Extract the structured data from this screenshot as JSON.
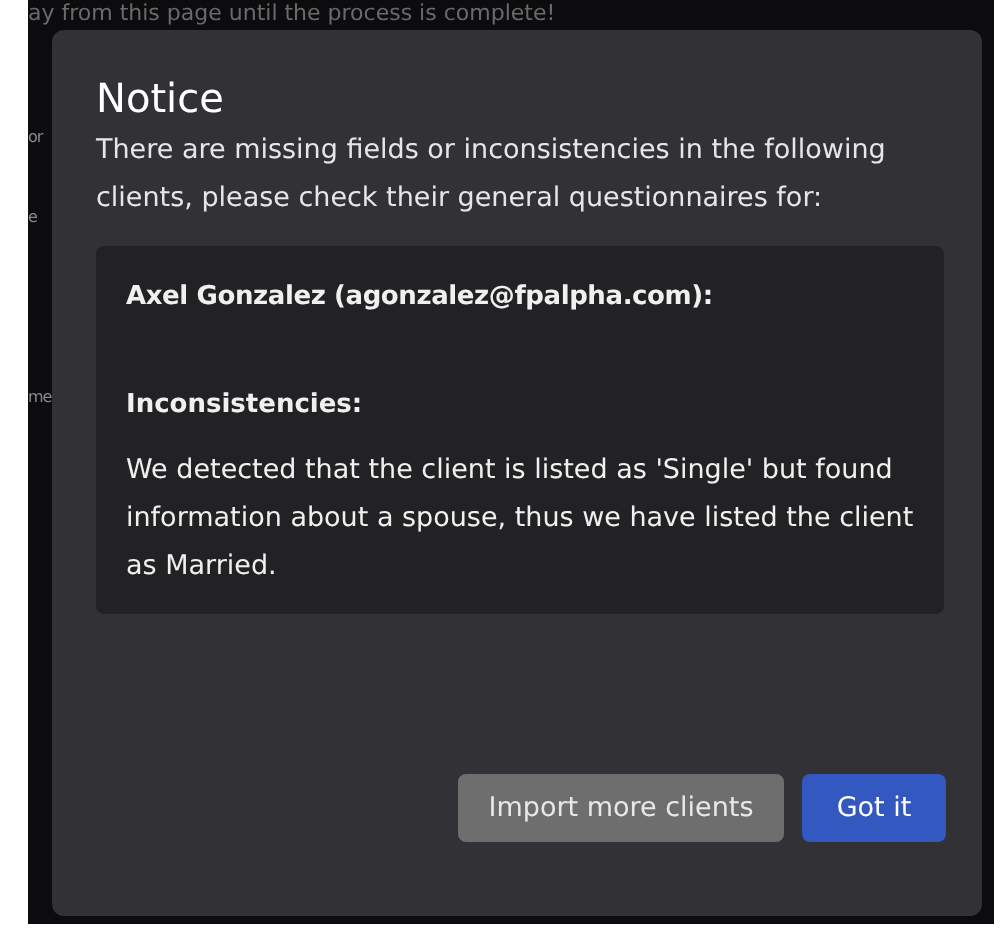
{
  "background_page": {
    "banner": "ay from this page until the process is complete!",
    "row_fragments": [
      "or",
      "e",
      "me"
    ]
  },
  "dialog": {
    "title": "Notice",
    "message": "There are missing fields or inconsistencies in the following clients, please check their general questionnaires for:",
    "clients": [
      {
        "heading": "Axel Gonzalez (agonzalez@fpalpha.com):",
        "section_title": "Inconsistencies:",
        "detail": "We detected that the client is listed as 'Single' but found information about a spouse, thus we have listed the client as Married."
      }
    ],
    "buttons": [
      {
        "label": "Import more clients",
        "kind": "secondary"
      },
      {
        "label": "Got it",
        "kind": "primary"
      }
    ]
  }
}
